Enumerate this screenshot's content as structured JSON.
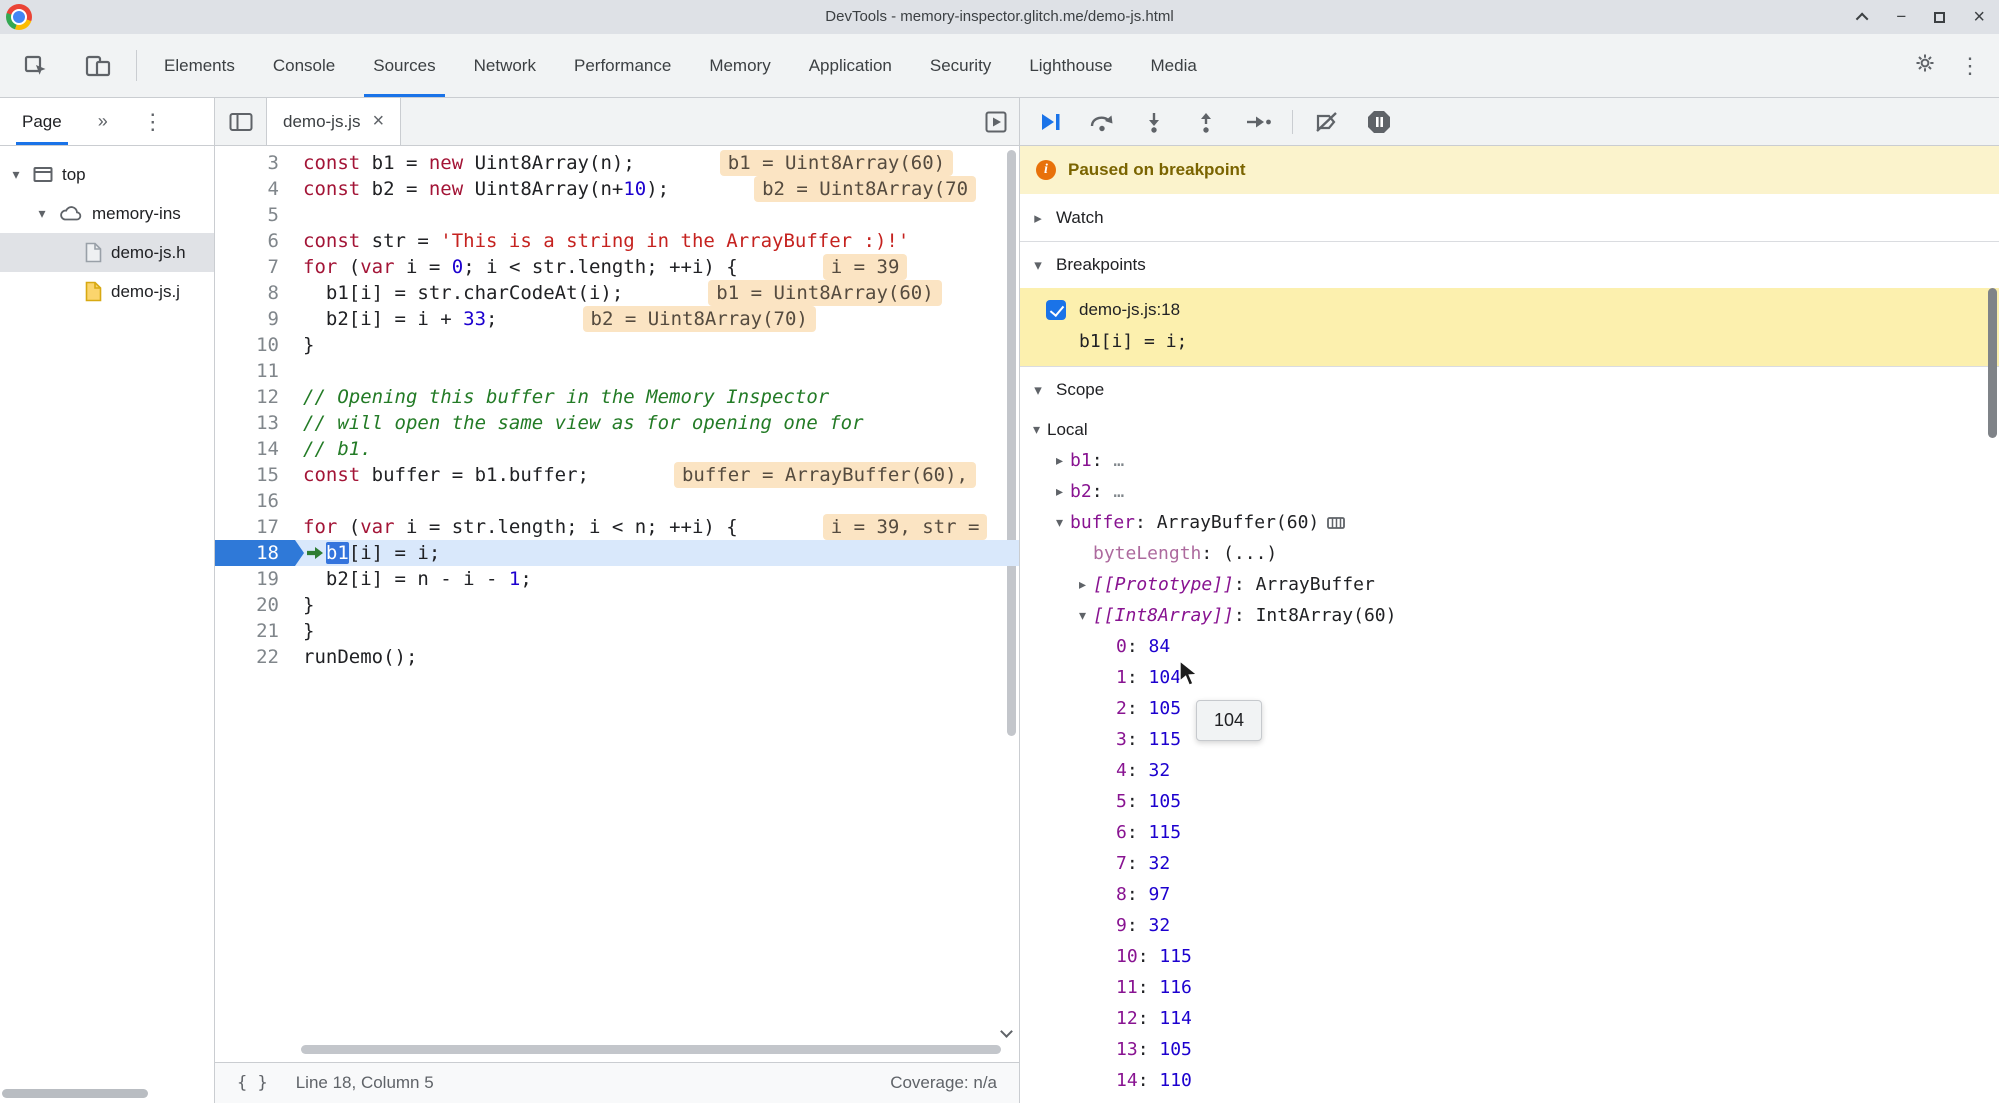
{
  "titlebar": {
    "title": "DevTools - memory-inspector.glitch.me/demo-js.html"
  },
  "toolbar": {
    "tabs": [
      {
        "label": "Elements"
      },
      {
        "label": "Console"
      },
      {
        "label": "Sources"
      },
      {
        "label": "Network"
      },
      {
        "label": "Performance"
      },
      {
        "label": "Memory"
      },
      {
        "label": "Application"
      },
      {
        "label": "Security"
      },
      {
        "label": "Lighthouse"
      },
      {
        "label": "Media"
      }
    ],
    "active": "Sources"
  },
  "sidebar": {
    "tab_label": "Page",
    "tree": [
      {
        "label": "top",
        "icon": "frame",
        "expander": "down",
        "indent": 0
      },
      {
        "label": "memory-ins",
        "icon": "cloud",
        "expander": "down",
        "indent": 1
      },
      {
        "label": "demo-js.h",
        "icon": "file-html",
        "expander": "none",
        "indent": 2,
        "selected": true
      },
      {
        "label": "demo-js.j",
        "icon": "file-js",
        "expander": "none",
        "indent": 2
      }
    ]
  },
  "editor": {
    "tab": {
      "label": "demo-js.js"
    },
    "status": {
      "line_col": "Line 18, Column 5",
      "coverage": "Coverage: n/a"
    },
    "code": {
      "lines": [
        {
          "no": 3,
          "tokens": [
            [
              "k",
              "const"
            ],
            [
              "p",
              " b1 = "
            ],
            [
              "k",
              "new"
            ],
            [
              "p",
              " Uint8Array(n);"
            ]
          ],
          "eval": "b1 = Uint8Array(60)"
        },
        {
          "no": 4,
          "tokens": [
            [
              "k",
              "const"
            ],
            [
              "p",
              " b2 = "
            ],
            [
              "k",
              "new"
            ],
            [
              "p",
              " Uint8Array(n+"
            ],
            [
              "n",
              "10"
            ],
            [
              "p",
              ");"
            ]
          ],
          "eval": "b2 = Uint8Array(70"
        },
        {
          "no": 5,
          "tokens": []
        },
        {
          "no": 6,
          "tokens": [
            [
              "k",
              "const"
            ],
            [
              "p",
              " str = "
            ],
            [
              "s",
              "'This is a string in the ArrayBuffer :)!'"
            ]
          ]
        },
        {
          "no": 7,
          "tokens": [
            [
              "k",
              "for"
            ],
            [
              "p",
              " ("
            ],
            [
              "k",
              "var"
            ],
            [
              "p",
              " i = "
            ],
            [
              "n",
              "0"
            ],
            [
              "p",
              "; i < str.length; ++i) {"
            ]
          ],
          "eval": "i = 39"
        },
        {
          "no": 8,
          "tokens": [
            [
              "p",
              "  b1[i] = str.charCodeAt(i);"
            ]
          ],
          "eval": "b1 = Uint8Array(60)"
        },
        {
          "no": 9,
          "tokens": [
            [
              "p",
              "  b2[i] = i + "
            ],
            [
              "n",
              "33"
            ],
            [
              "p",
              ";"
            ]
          ],
          "eval": "b2 = Uint8Array(70)"
        },
        {
          "no": 10,
          "tokens": [
            [
              "p",
              "}"
            ]
          ]
        },
        {
          "no": 11,
          "tokens": []
        },
        {
          "no": 12,
          "tokens": [
            [
              "c",
              "// Opening this buffer in the Memory Inspector"
            ]
          ]
        },
        {
          "no": 13,
          "tokens": [
            [
              "c",
              "// will open the same view as for opening one for"
            ]
          ]
        },
        {
          "no": 14,
          "tokens": [
            [
              "c",
              "// b1."
            ]
          ]
        },
        {
          "no": 15,
          "tokens": [
            [
              "k",
              "const"
            ],
            [
              "p",
              " buffer = b1.buffer;"
            ]
          ],
          "eval": "buffer = ArrayBuffer(60),"
        },
        {
          "no": 16,
          "tokens": []
        },
        {
          "no": 17,
          "tokens": [
            [
              "k",
              "for"
            ],
            [
              "p",
              " ("
            ],
            [
              "k",
              "var"
            ],
            [
              "p",
              " i = str.length; i < n; ++i) {"
            ]
          ],
          "eval": "i = 39, str ="
        },
        {
          "no": 18,
          "tokens": [
            [
              "p",
              "  "
            ],
            [
              "sel",
              "b1"
            ],
            [
              "p",
              "[i] = i;"
            ]
          ],
          "current": true
        },
        {
          "no": 19,
          "tokens": [
            [
              "p",
              "  b2[i] = n - i - "
            ],
            [
              "n",
              "1"
            ],
            [
              "p",
              ";"
            ]
          ]
        },
        {
          "no": 20,
          "tokens": [
            [
              "p",
              "}"
            ]
          ]
        },
        {
          "no": 21,
          "tokens": [
            [
              "p",
              "}"
            ]
          ]
        },
        {
          "no": 22,
          "tokens": [
            [
              "p",
              "runDemo();"
            ]
          ]
        }
      ]
    }
  },
  "debugger": {
    "paused_message": "Paused on breakpoint",
    "watch_label": "Watch",
    "breakpoints_label": "Breakpoints",
    "scope_label": "Scope",
    "breakpoint": {
      "checked": true,
      "location": "demo-js.js:18",
      "code": "b1[i] = i;"
    },
    "scope": {
      "rows": [
        {
          "indent": 0,
          "arrow": "down",
          "name": "Local",
          "kind": "section"
        },
        {
          "indent": 1,
          "arrow": "right",
          "name": "b1",
          "value": "…",
          "vclass": "dim"
        },
        {
          "indent": 1,
          "arrow": "right",
          "name": "b2",
          "value": "…",
          "vclass": "dim"
        },
        {
          "indent": 1,
          "arrow": "down",
          "name": "buffer",
          "value": "ArrayBuffer(60)",
          "vclass": "obj",
          "icon": "memory"
        },
        {
          "indent": 2,
          "arrow": "none",
          "name": "byteLength",
          "nclass": "accessor",
          "value": "(...)",
          "vclass": "obj"
        },
        {
          "indent": 2,
          "arrow": "right",
          "name": "[[Prototype]]",
          "nclass": "internal",
          "value": "ArrayBuffer",
          "vclass": "obj"
        },
        {
          "indent": 2,
          "arrow": "down",
          "name": "[[Int8Array]]",
          "nclass": "internal",
          "value": "Int8Array(60)",
          "vclass": "obj"
        },
        {
          "indent": 3,
          "arrow": "none",
          "name": "0",
          "value": "84",
          "vclass": "num"
        },
        {
          "indent": 3,
          "arrow": "none",
          "name": "1",
          "value": "104",
          "vclass": "num"
        },
        {
          "indent": 3,
          "arrow": "none",
          "name": "2",
          "value": "105",
          "vclass": "num"
        },
        {
          "indent": 3,
          "arrow": "none",
          "name": "3",
          "value": "115",
          "vclass": "num"
        },
        {
          "indent": 3,
          "arrow": "none",
          "name": "4",
          "value": "32",
          "vclass": "num"
        },
        {
          "indent": 3,
          "arrow": "none",
          "name": "5",
          "value": "105",
          "vclass": "num"
        },
        {
          "indent": 3,
          "arrow": "none",
          "name": "6",
          "value": "115",
          "vclass": "num"
        },
        {
          "indent": 3,
          "arrow": "none",
          "name": "7",
          "value": "32",
          "vclass": "num"
        },
        {
          "indent": 3,
          "arrow": "none",
          "name": "8",
          "value": "97",
          "vclass": "num"
        },
        {
          "indent": 3,
          "arrow": "none",
          "name": "9",
          "value": "32",
          "vclass": "num"
        },
        {
          "indent": 3,
          "arrow": "none",
          "name": "10",
          "value": "115",
          "vclass": "num"
        },
        {
          "indent": 3,
          "arrow": "none",
          "name": "11",
          "value": "116",
          "vclass": "num"
        },
        {
          "indent": 3,
          "arrow": "none",
          "name": "12",
          "value": "114",
          "vclass": "num"
        },
        {
          "indent": 3,
          "arrow": "none",
          "name": "13",
          "value": "105",
          "vclass": "num"
        },
        {
          "indent": 3,
          "arrow": "none",
          "name": "14",
          "value": "110",
          "vclass": "num"
        }
      ]
    },
    "tooltip": "104"
  },
  "icons": {
    "info": "i",
    "more_tabs": "»",
    "kebab": "⋮",
    "tab_close": "×",
    "window_minimize": "−",
    "window_close": "×",
    "expander_down": "▾",
    "expander_right": "▸",
    "pretty_print": "{ }"
  },
  "colors": {
    "accent_blue": "#1a73e8",
    "paused_banner_bg": "#fbf3cc",
    "breakpoint_entry_bg": "#fcf0ae",
    "current_line_bg": "#d9e8fb",
    "inline_eval_bg": "#fbe4c3"
  }
}
